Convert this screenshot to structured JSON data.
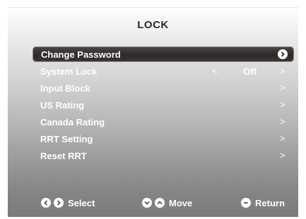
{
  "title": "LOCK",
  "menu": {
    "items": [
      {
        "label": "Change Password",
        "selected": true,
        "icon": "chevron-right-circle-icon"
      },
      {
        "label": "System Lock",
        "prev": "<",
        "value": "Off",
        "next": ">"
      },
      {
        "label": "Input Block",
        "next": ">"
      },
      {
        "label": "US Rating",
        "next": ">"
      },
      {
        "label": "Canada Rating",
        "next": ">"
      },
      {
        "label": "RRT Setting",
        "next": ">"
      },
      {
        "label": "Reset RRT",
        "next": ">"
      }
    ]
  },
  "footer": {
    "select_label": "Select",
    "move_label": "Move",
    "return_label": "Return"
  },
  "colors": {
    "selected_bar": "#2e2a28",
    "text": "#ffffff",
    "title": "#2a2a2a"
  }
}
